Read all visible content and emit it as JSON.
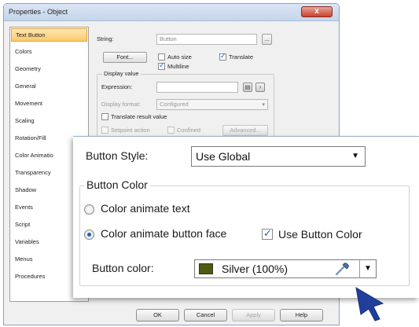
{
  "window": {
    "title": "Properties - Object",
    "close_glyph": "x"
  },
  "sidebar": {
    "items": [
      {
        "label": "Text Button",
        "selected": true
      },
      {
        "label": "Colors"
      },
      {
        "label": "Geometry"
      },
      {
        "label": "General"
      },
      {
        "label": "Movement"
      },
      {
        "label": "Scaling"
      },
      {
        "label": "Rotation/Fill"
      },
      {
        "label": "Color Animatio"
      },
      {
        "label": "Transparency"
      },
      {
        "label": "Shadow"
      },
      {
        "label": "Events"
      },
      {
        "label": "Script"
      },
      {
        "label": "Variables"
      },
      {
        "label": "Menus"
      },
      {
        "label": "Procedures"
      }
    ]
  },
  "panel": {
    "string_label": "String:",
    "string_value": "Button",
    "ellipsis": "...",
    "font_button": "Font...",
    "auto_size": {
      "label": "Auto size",
      "checked": false
    },
    "translate": {
      "label": "Translate",
      "checked": true
    },
    "multiline": {
      "label": "Multiline",
      "checked": true
    },
    "display_value": {
      "title": "Display value",
      "expression_label": "Expression:",
      "expression_value": "",
      "display_format_label": "Display format:",
      "display_format_value": "Configured",
      "translate_result": {
        "label": "Translate result value",
        "checked": false
      },
      "setpoint_action": {
        "label": "Setpoint action",
        "checked": false
      },
      "confined": {
        "label": "Confined",
        "checked": false
      },
      "advanced_button": "Advanced..."
    }
  },
  "buttons": {
    "ok": "OK",
    "cancel": "Cancel",
    "apply": "Apply",
    "help": "Help"
  },
  "callout": {
    "button_style_label": "Button Style:",
    "button_style_value": "Use Global",
    "button_color_group": "Button Color",
    "option_text": {
      "label": "Color animate text",
      "selected": false
    },
    "option_face": {
      "label": "Color animate button face",
      "selected": true
    },
    "use_button_color": {
      "label": "Use Button Color",
      "checked": true
    },
    "button_color_label": "Button color:",
    "button_color_value": "Silver (100%)",
    "swatch_color": "#4f5a0e",
    "check_glyph": "✓",
    "dropdown_glyph": "▼"
  }
}
